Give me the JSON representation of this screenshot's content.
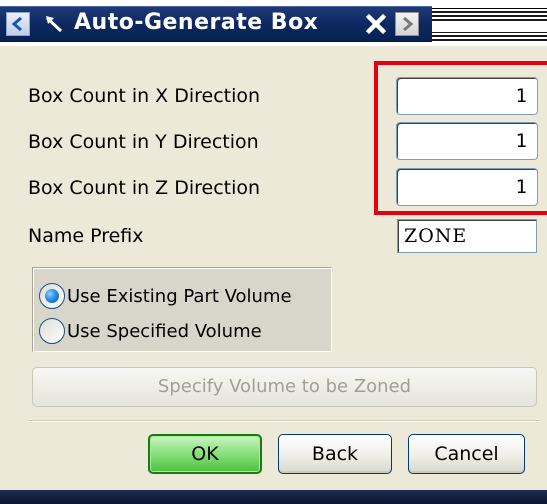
{
  "titlebar": {
    "title": "Auto-Generate Box",
    "prev_icon": "chevron-left-icon",
    "pin_icon": "pin-arrow-icon",
    "close_icon": "close-icon",
    "next_icon": "chevron-right-icon"
  },
  "fields": {
    "box_count_x": {
      "label": "Box Count in X Direction",
      "value": "1"
    },
    "box_count_y": {
      "label": "Box Count in Y Direction",
      "value": "1"
    },
    "box_count_z": {
      "label": "Box Count in Z Direction",
      "value": "1"
    },
    "name_prefix": {
      "label": "Name Prefix",
      "value": "ZONE"
    }
  },
  "volume_options": [
    {
      "label": "Use Existing Part Volume",
      "selected": true
    },
    {
      "label": "Use Specified Volume",
      "selected": false
    }
  ],
  "specify_button": {
    "label": "Specify Volume to be Zoned",
    "enabled": false
  },
  "buttons": {
    "ok": "OK",
    "back": "Back",
    "cancel": "Cancel"
  },
  "colors": {
    "highlight": "#e3000f",
    "ok_button": "#6fd363",
    "titlebar": "#0e2a63",
    "dialog_bg": "#ece9d8"
  }
}
